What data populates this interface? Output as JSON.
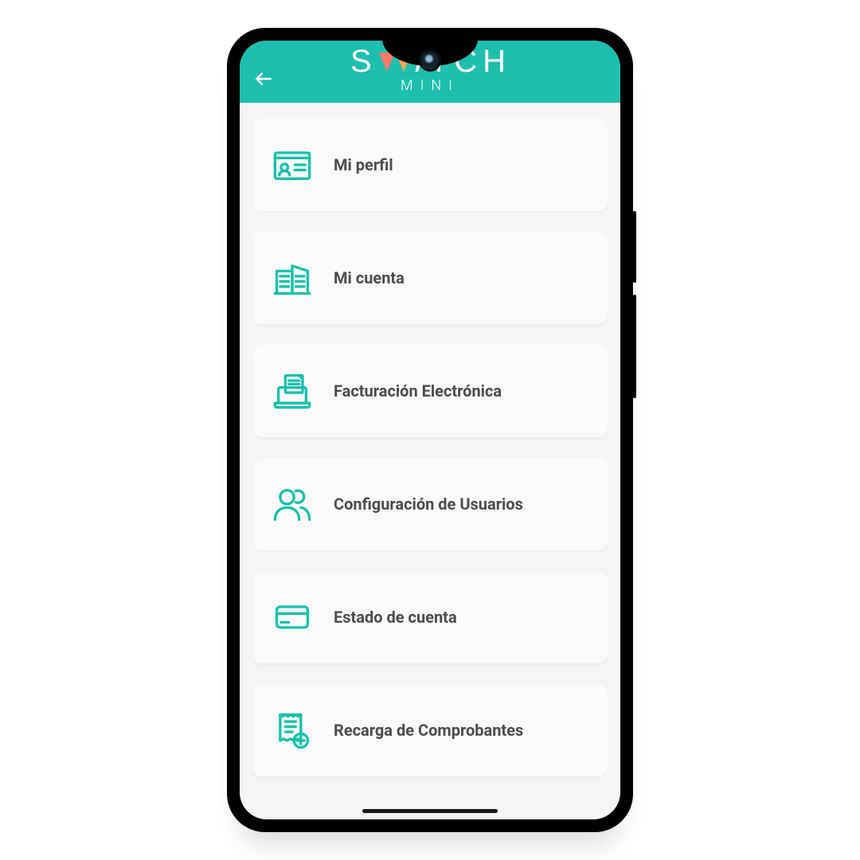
{
  "brand": {
    "name_main": "SWITCH",
    "name_sub": "MINI"
  },
  "colors": {
    "accent": "#1ebfae",
    "icon": "#11c2aa",
    "card_bg": "#fbfafb",
    "screen_bg": "#f6f4f6",
    "text": "#4b4b4b"
  },
  "menu": {
    "items": [
      {
        "label": "Mi perfil",
        "icon": "profile-card-icon"
      },
      {
        "label": "Mi cuenta",
        "icon": "buildings-icon"
      },
      {
        "label": "Facturación Electrónica",
        "icon": "laptop-invoice-icon"
      },
      {
        "label": "Configuración de Usuarios",
        "icon": "users-icon"
      },
      {
        "label": "Estado de cuenta",
        "icon": "credit-card-icon"
      },
      {
        "label": "Recarga de Comprobantes",
        "icon": "receipt-plus-icon"
      }
    ]
  }
}
